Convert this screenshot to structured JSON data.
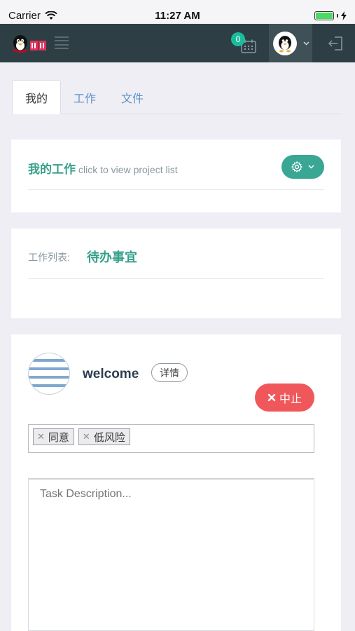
{
  "status_bar": {
    "carrier": "Carrier",
    "time": "11:27 AM"
  },
  "navbar": {
    "notification_count": "0"
  },
  "tabs": [
    {
      "label": "我的"
    },
    {
      "label": "工作"
    },
    {
      "label": "文件"
    }
  ],
  "my_work": {
    "title": "我的工作",
    "subtitle": "click to view project list"
  },
  "work_list": {
    "label": "工作列表:",
    "value": "待办事宜"
  },
  "workflow": {
    "name": "welcome",
    "detail_label": "详情",
    "abort_label": "中止",
    "tags": [
      {
        "label": "同意"
      },
      {
        "label": "低风险"
      }
    ],
    "description_placeholder": "Task Description..."
  },
  "colors": {
    "navbar": "#2d3f45",
    "accent": "#35a08a",
    "danger": "#f0575a",
    "badge": "#1abc9c"
  }
}
